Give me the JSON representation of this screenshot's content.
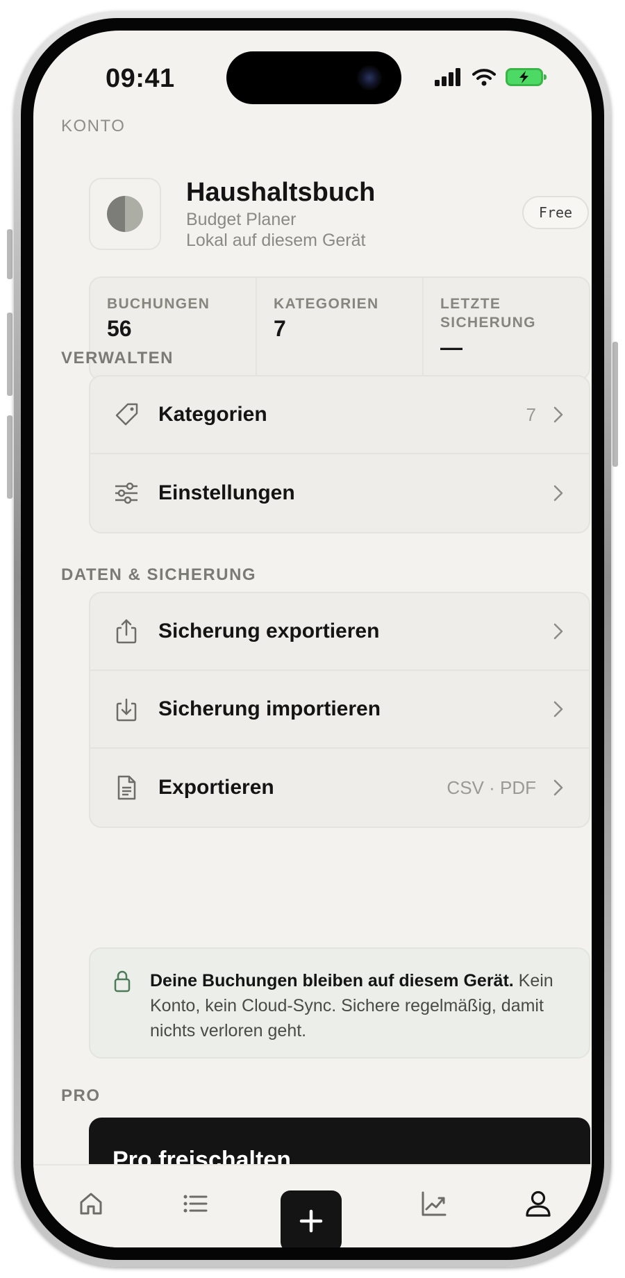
{
  "status_bar": {
    "time": "09:41"
  },
  "account": {
    "section_label": "KONTO",
    "app_name": "Haushaltsbuch",
    "subtitle": "Budget Planer",
    "storage_note": "Lokal auf diesem Gerät",
    "plan_badge": "Free"
  },
  "stats": [
    {
      "label": "BUCHUNGEN",
      "value": "56"
    },
    {
      "label": "KATEGORIEN",
      "value": "7"
    },
    {
      "label": "LETZTE SICHERUNG",
      "value": "—"
    }
  ],
  "manage": {
    "section_label": "VERWALTEN",
    "items": [
      {
        "label": "Kategorien",
        "meta": "7",
        "icon": "tag-icon"
      },
      {
        "label": "Einstellungen",
        "meta": "",
        "icon": "sliders-icon"
      }
    ]
  },
  "data_backup": {
    "section_label": "DATEN & SICHERUNG",
    "items": [
      {
        "label": "Sicherung exportieren",
        "meta": "",
        "icon": "upload-icon"
      },
      {
        "label": "Sicherung importieren",
        "meta": "",
        "icon": "download-icon"
      },
      {
        "label": "Exportieren",
        "meta": "CSV · PDF",
        "icon": "document-icon"
      }
    ]
  },
  "privacy_note": {
    "bold": "Deine Buchungen bleiben auf diesem Gerät.",
    "text": " Kein Konto, kein Cloud-Sync. Sichere regelmäßig, damit nichts verloren geht."
  },
  "pro": {
    "section_label": "PRO",
    "unlock_label": "Pro freischalten"
  },
  "tabbar": {
    "tabs": [
      "home-icon",
      "list-icon",
      "add-icon",
      "chart-icon",
      "profile-icon"
    ],
    "active": "profile-icon"
  },
  "colors": {
    "background": "#f3f2ee",
    "card": "#eeede9",
    "accent_dark": "#141414",
    "muted_text": "#8a8a85",
    "battery_green": "#4cd964"
  }
}
